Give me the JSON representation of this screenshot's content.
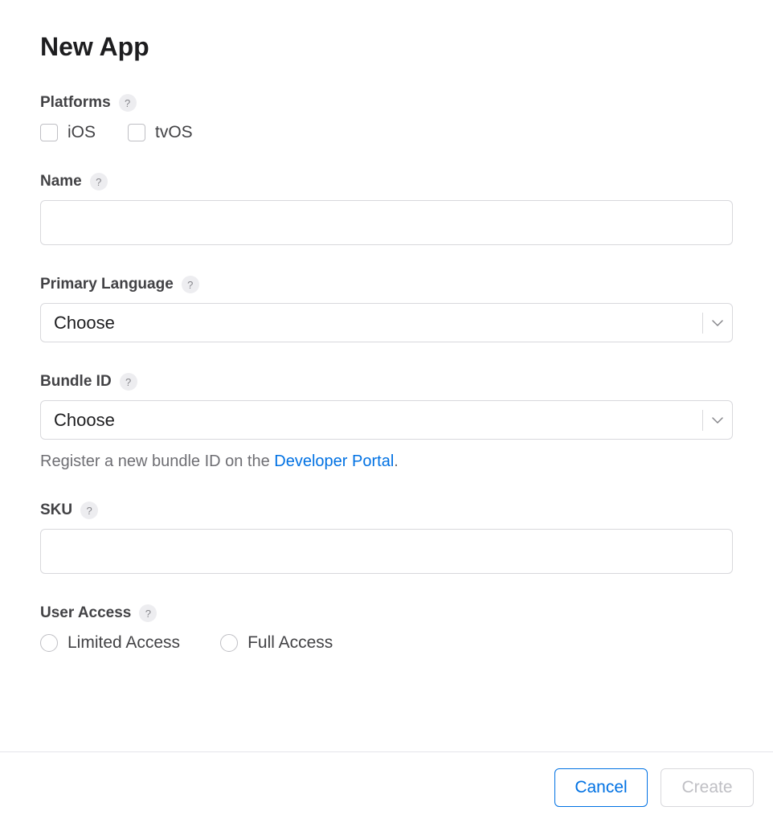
{
  "title": "New App",
  "platforms": {
    "label": "Platforms",
    "options": [
      {
        "label": "iOS"
      },
      {
        "label": "tvOS"
      }
    ]
  },
  "name": {
    "label": "Name",
    "value": ""
  },
  "primaryLanguage": {
    "label": "Primary Language",
    "selected": "Choose"
  },
  "bundleId": {
    "label": "Bundle ID",
    "selected": "Choose",
    "hintPrefix": "Register a new bundle ID on the ",
    "hintLink": "Developer Portal",
    "hintSuffix": "."
  },
  "sku": {
    "label": "SKU",
    "value": ""
  },
  "userAccess": {
    "label": "User Access",
    "options": [
      {
        "label": "Limited Access"
      },
      {
        "label": "Full Access"
      }
    ]
  },
  "footer": {
    "cancel": "Cancel",
    "create": "Create"
  },
  "helpGlyph": "?"
}
